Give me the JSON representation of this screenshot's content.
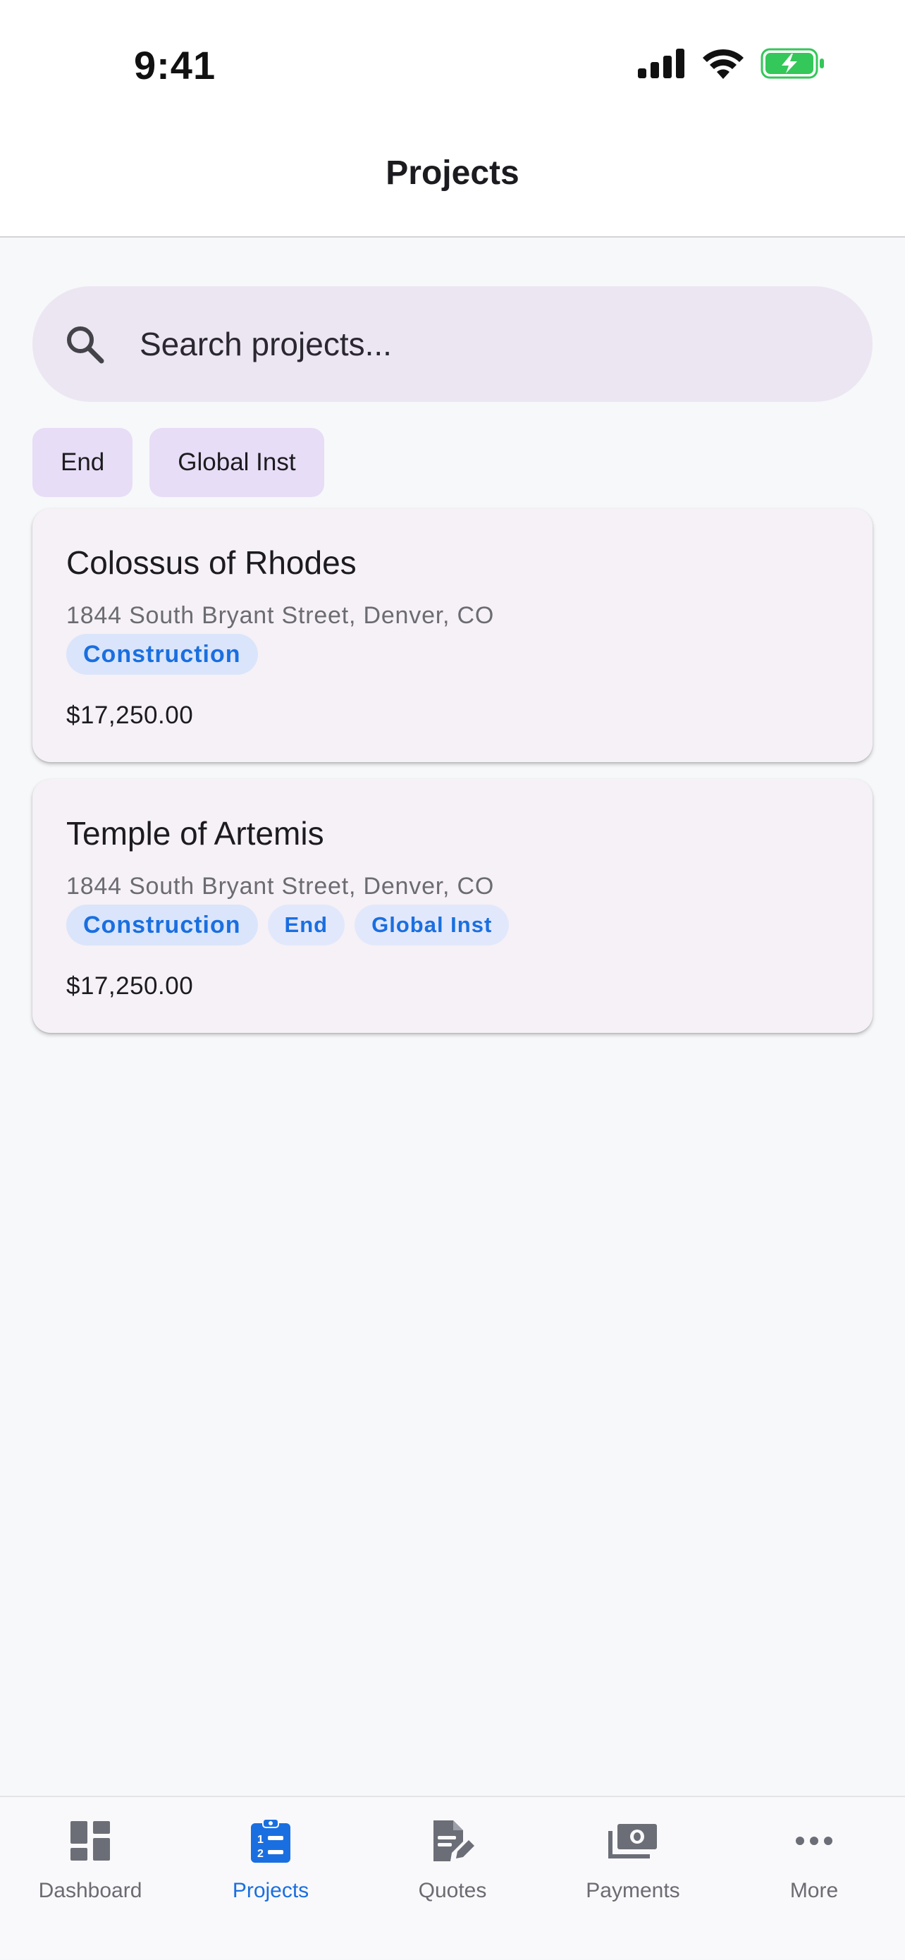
{
  "status_bar": {
    "time": "9:41"
  },
  "header": {
    "title": "Projects"
  },
  "search": {
    "placeholder": "Search projects..."
  },
  "filters": [
    "End",
    "Global Inst"
  ],
  "projects": [
    {
      "name": "Colossus of Rhodes",
      "address": "1844 South Bryant Street, Denver, CO",
      "tags": [
        "Construction"
      ],
      "amount": "$17,250.00"
    },
    {
      "name": "Temple of Artemis",
      "address": "1844 South Bryant Street, Denver, CO",
      "tags": [
        "Construction",
        "End",
        "Global Inst"
      ],
      "amount": "$17,250.00"
    }
  ],
  "tabs": [
    {
      "label": "Dashboard",
      "icon": "dashboard-icon",
      "active": false
    },
    {
      "label": "Projects",
      "icon": "clipboard-list-icon",
      "active": true
    },
    {
      "label": "Quotes",
      "icon": "document-edit-icon",
      "active": false
    },
    {
      "label": "Payments",
      "icon": "cash-icon",
      "active": false
    },
    {
      "label": "More",
      "icon": "more-horizontal-icon",
      "active": false
    }
  ],
  "colors": {
    "accent": "#1a6fe0",
    "search_bg": "#ece6f2",
    "chip_bg": "#e7ddf6",
    "card_bg": "#f6f1f6",
    "tag_bg": "#dae5fb",
    "battery_green": "#34c759"
  }
}
